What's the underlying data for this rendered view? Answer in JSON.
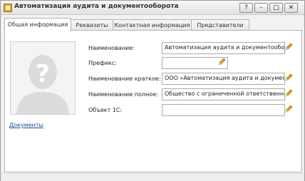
{
  "window": {
    "title": "Автоматизация аудита и документооборота",
    "buttons": {
      "help": "?",
      "minimize": "–",
      "maximize": "□",
      "close": "✕"
    }
  },
  "tabs": [
    {
      "label": "Общая информация",
      "active": true
    },
    {
      "label": "Реквизиты",
      "active": false
    },
    {
      "label": "Контактная информация",
      "active": false
    },
    {
      "label": "Представители",
      "active": false
    }
  ],
  "form": {
    "name": {
      "label": "Наименование:",
      "value": "Автоматизация аудита и документооборота"
    },
    "prefix": {
      "label": "Префикс:",
      "value": ""
    },
    "short_name": {
      "label": "Наименование краткое:",
      "value": "ООО «Автоматизация аудита и документооборота»"
    },
    "full_name": {
      "label": "Наименование полное:",
      "value": "Общество с ограниченной ответственностью «Автоматизация аудита и документооборота»"
    },
    "object_1c": {
      "label": "Объект 1С:",
      "value": ""
    }
  },
  "documents_link": "Документы",
  "colors": {
    "accent_pencil": "#e8a317",
    "link": "#1c4f9c"
  },
  "icons": [
    "app-icon",
    "avatar-placeholder-icon",
    "pencil-icon"
  ]
}
